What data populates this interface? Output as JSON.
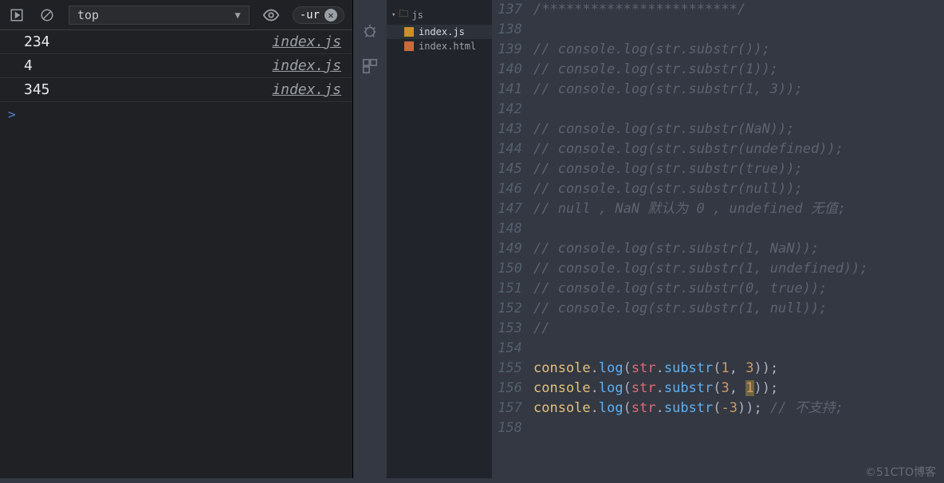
{
  "devtools": {
    "context": "top",
    "filter": "-ur",
    "logs": [
      {
        "value": "234",
        "source": "index.js"
      },
      {
        "value": "4",
        "source": "index.js"
      },
      {
        "value": "345",
        "source": "index.js"
      }
    ],
    "prompt": ">"
  },
  "sidebar": {
    "folder": "js",
    "files": [
      {
        "name": "index.js",
        "kind": "js",
        "selected": true
      },
      {
        "name": "index.html",
        "kind": "html",
        "selected": false
      }
    ]
  },
  "editor": {
    "lines": [
      {
        "n": 137,
        "type": "cmt",
        "text": "/************************/"
      },
      {
        "n": 138,
        "type": "blank",
        "text": ""
      },
      {
        "n": 139,
        "type": "cmt",
        "text": "// console.log(str.substr());"
      },
      {
        "n": 140,
        "type": "cmt",
        "text": "// console.log(str.substr(1));"
      },
      {
        "n": 141,
        "type": "cmt",
        "text": "// console.log(str.substr(1, 3));"
      },
      {
        "n": 142,
        "type": "blank",
        "text": ""
      },
      {
        "n": 143,
        "type": "cmt",
        "text": "// console.log(str.substr(NaN));"
      },
      {
        "n": 144,
        "type": "cmt",
        "text": "// console.log(str.substr(undefined));"
      },
      {
        "n": 145,
        "type": "cmt",
        "text": "// console.log(str.substr(true));"
      },
      {
        "n": 146,
        "type": "cmt",
        "text": "// console.log(str.substr(null));"
      },
      {
        "n": 147,
        "type": "cmt",
        "text": "// null , NaN 默认为 0 , undefined 无值;"
      },
      {
        "n": 148,
        "type": "blank",
        "text": ""
      },
      {
        "n": 149,
        "type": "cmt",
        "text": "// console.log(str.substr(1, NaN));"
      },
      {
        "n": 150,
        "type": "cmt",
        "text": "// console.log(str.substr(1, undefined));"
      },
      {
        "n": 151,
        "type": "cmt",
        "text": "// console.log(str.substr(0, true));"
      },
      {
        "n": 152,
        "type": "cmt",
        "text": "// console.log(str.substr(1, null));"
      },
      {
        "n": 153,
        "type": "cmt",
        "text": "//"
      },
      {
        "n": 154,
        "type": "blank",
        "text": ""
      },
      {
        "n": 155,
        "type": "code",
        "a": "1",
        "b": "3",
        "tail": ""
      },
      {
        "n": 156,
        "type": "code",
        "a": "3",
        "b": "1",
        "tail": "",
        "caret": true
      },
      {
        "n": 157,
        "type": "code",
        "a": "-3",
        "b": null,
        "tail": " // 不支持;"
      },
      {
        "n": 158,
        "type": "blank",
        "text": ""
      }
    ]
  },
  "watermark": "©51CTO博客"
}
